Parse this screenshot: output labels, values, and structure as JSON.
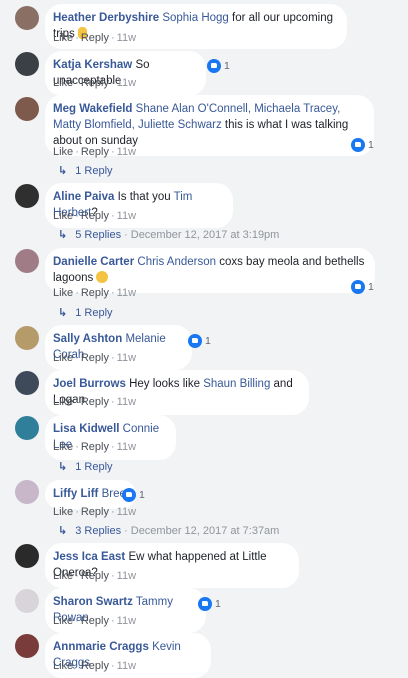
{
  "actions": {
    "like": "Like",
    "reply": "Reply",
    "sep": "·"
  },
  "comments": [
    {
      "author": "Heather Derbyshire",
      "tag": "Sophia Hogg",
      "text": " for all our upcoming trips ",
      "time": "11w",
      "avatar_color": "#8a6f64"
    },
    {
      "author": "Katja Kershaw",
      "tag": "",
      "text": "So unacceptable",
      "time": "11w",
      "reactions": "1",
      "avatar_color": "#3b3f46"
    },
    {
      "author": "Meg Wakefield",
      "tag": "Shane Alan O'Connell, Michaela Tracey, Matty Blomfield, Juliette Schwarz",
      "text": " this is what I was talking about on sunday",
      "time": "11w",
      "reactions": "1",
      "replies_label": "1 Reply",
      "avatar_color": "#7d5a4c"
    },
    {
      "author": "Aline Paiva",
      "tag": "",
      "text": "Is that you ",
      "tag2": "Tim Herbert",
      "text2": "?",
      "time": "11w",
      "replies_label": "5 Replies",
      "replies_time": "December 12, 2017 at 3:19pm",
      "avatar_color": "#2f2f2f"
    },
    {
      "author": "Danielle Carter",
      "tag": "Chris Anderson",
      "text": " coxs bay meola and bethells lagoons ",
      "time": "11w",
      "reactions": "1",
      "replies_label": "1 Reply",
      "avatar_color": "#a07d86"
    },
    {
      "author": "Sally Ashton",
      "tag": "Melanie Corah",
      "text": "",
      "time": "11w",
      "reactions": "1",
      "avatar_color": "#b59a6a"
    },
    {
      "author": "Joel Burrows",
      "tag": "",
      "text": "Hey looks like ",
      "tag2": "Shaun Billing",
      "text2": " and Logan",
      "time": "11w",
      "avatar_color": "#3e4a5a"
    },
    {
      "author": "Lisa Kidwell",
      "tag": "Connie Lee",
      "text": "",
      "time": "11w",
      "replies_label": "1 Reply",
      "avatar_color": "#2f7f9a"
    },
    {
      "author": "Liffy Liff",
      "tag": "Bree",
      "text": "",
      "time": "11w",
      "reactions": "1",
      "replies_label": "3 Replies",
      "replies_time": "December 12, 2017 at 7:37am",
      "avatar_color": "#c7b7c9"
    },
    {
      "author": "Jess Ica East",
      "tag": "",
      "text": "Ew what happened at Little Oneroa?",
      "time": "11w",
      "avatar_color": "#2a2a2a"
    },
    {
      "author": "Sharon Swartz",
      "tag": "Tammy Rowan",
      "text": "",
      "time": "11w",
      "reactions": "1",
      "avatar_color": "#d9d4d9"
    },
    {
      "author": "Annmarie Craggs",
      "tag": "Kevin Craggs",
      "text": "",
      "time": "11w",
      "avatar_color": "#7a3b3b"
    }
  ]
}
